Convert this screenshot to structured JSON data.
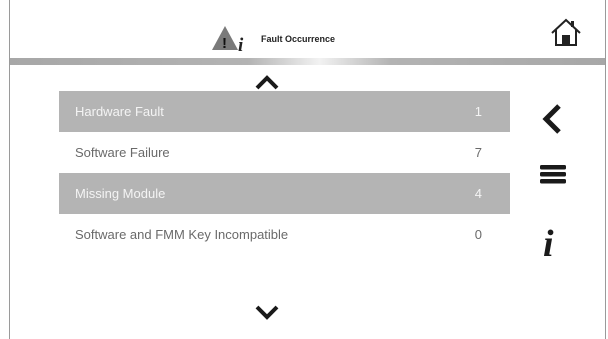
{
  "header": {
    "title": "Fault Occurrence",
    "title_icon": "warning-info-icon",
    "home_icon": "home-icon"
  },
  "navigation": {
    "scroll_up_icon": "chevron-up-icon",
    "scroll_down_icon": "chevron-down-icon",
    "back_icon": "chevron-left-icon",
    "menu_icon": "menu-icon",
    "info_icon": "info-icon"
  },
  "faults": [
    {
      "label": "Hardware Fault",
      "count": "1"
    },
    {
      "label": "Software Failure",
      "count": "7"
    },
    {
      "label": "Missing Module",
      "count": "4"
    },
    {
      "label": "Software and FMM Key Incompatible",
      "count": "0"
    }
  ],
  "colors": {
    "row_shaded": "#b4b4b4",
    "row_plain": "#ffffff",
    "icon": "#222222"
  }
}
